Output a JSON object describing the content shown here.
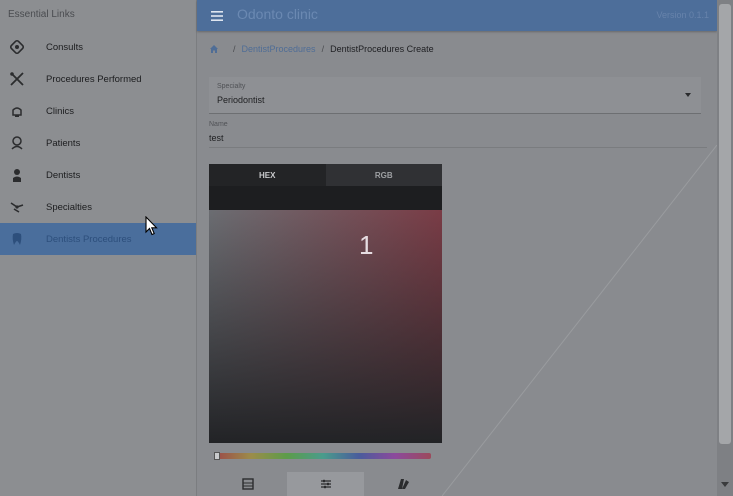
{
  "sidebar": {
    "header": "Essential Links",
    "items": [
      {
        "label": "Consults",
        "icon": "consults-icon"
      },
      {
        "label": "Procedures Performed",
        "icon": "tools-icon"
      },
      {
        "label": "Clinics",
        "icon": "clinic-icon"
      },
      {
        "label": "Patients",
        "icon": "patients-icon"
      },
      {
        "label": "Dentists",
        "icon": "dentist-icon"
      },
      {
        "label": "Specialties",
        "icon": "specialties-icon"
      },
      {
        "label": "Dentists Procedures",
        "icon": "tooth-icon",
        "active": true
      }
    ]
  },
  "appbar": {
    "title": "Odonto clinic",
    "version": "Version 0.1.1"
  },
  "breadcrumb": {
    "link": "DentistProcedures",
    "current": "DentistProcedures Create",
    "separator": "/"
  },
  "form": {
    "specialty_label": "Specialty",
    "specialty_value": "Periodontist",
    "name_label": "Name",
    "name_value": "test"
  },
  "picker": {
    "tabs": [
      "HEX",
      "RGB"
    ],
    "active_tab": "HEX",
    "overlay_text": "1",
    "mode_icons": [
      "palette-grid-icon",
      "sliders-icon",
      "swatches-icon"
    ]
  },
  "colors": {
    "primary": "#4d6e9a",
    "background": "#898b8f"
  }
}
